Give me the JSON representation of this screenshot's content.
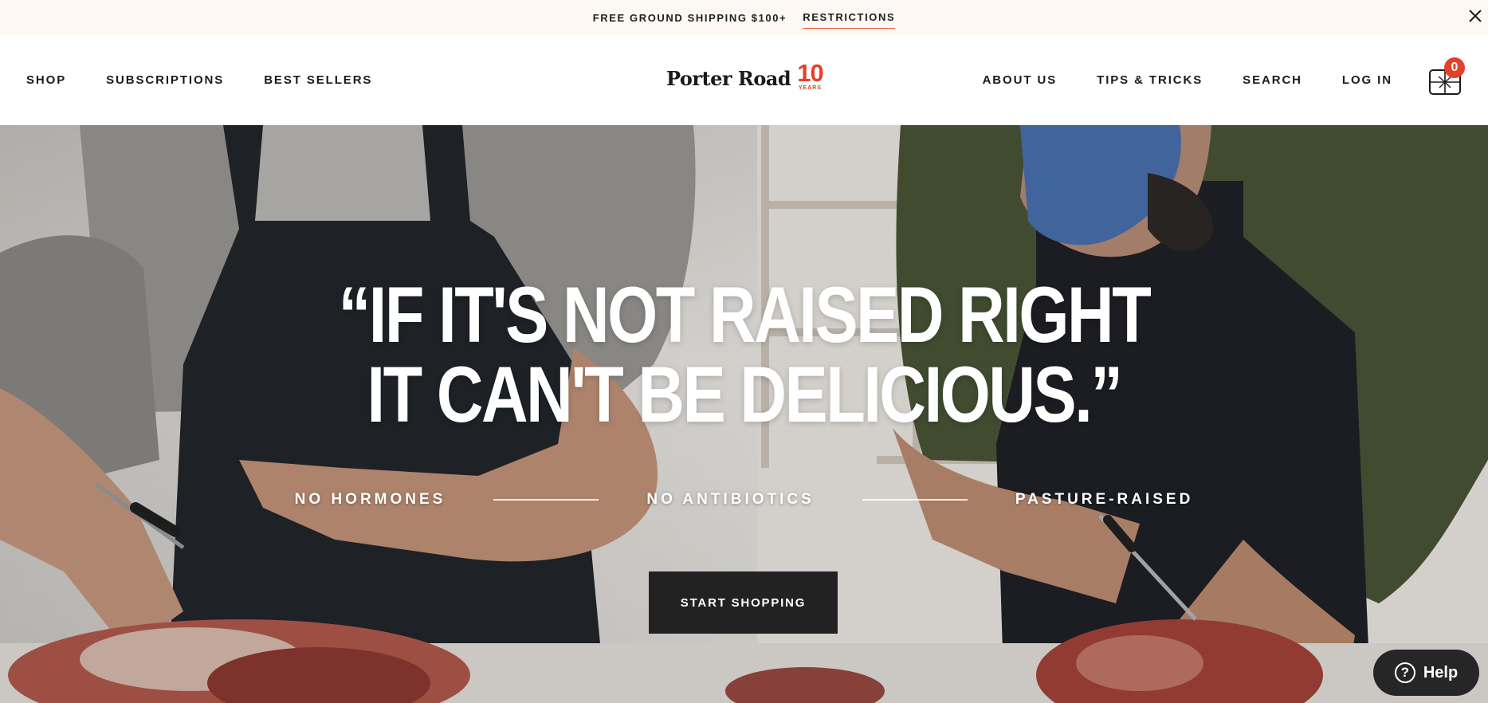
{
  "announcement": {
    "text": "FREE GROUND SHIPPING $100+",
    "link": "RESTRICTIONS"
  },
  "header": {
    "nav_left": [
      "SHOP",
      "SUBSCRIPTIONS",
      "BEST SELLERS"
    ],
    "nav_right": [
      "ABOUT US",
      "TIPS & TRICKS",
      "SEARCH",
      "LOG IN"
    ],
    "logo": {
      "wordmark": "Porter Road",
      "anniversary_number": "10",
      "anniversary_label": "YEARS"
    },
    "cart": {
      "icon": "cart-box-icon",
      "count": "0"
    }
  },
  "hero": {
    "quote_line_1": "“IF IT'S NOT RAISED RIGHT",
    "quote_line_2": "IT CAN'T BE DELICIOUS.”",
    "values": [
      "NO HORMONES",
      "NO ANTIBIOTICS",
      "PASTURE-RAISED"
    ],
    "cta": "START SHOPPING"
  },
  "help_widget": {
    "icon": "question-circle-icon",
    "label": "Help"
  },
  "colors": {
    "announcement_bg": "#fdf8f3",
    "accent": "#e4412b",
    "cta_bg": "#222222",
    "text": "#1a1a1a"
  }
}
